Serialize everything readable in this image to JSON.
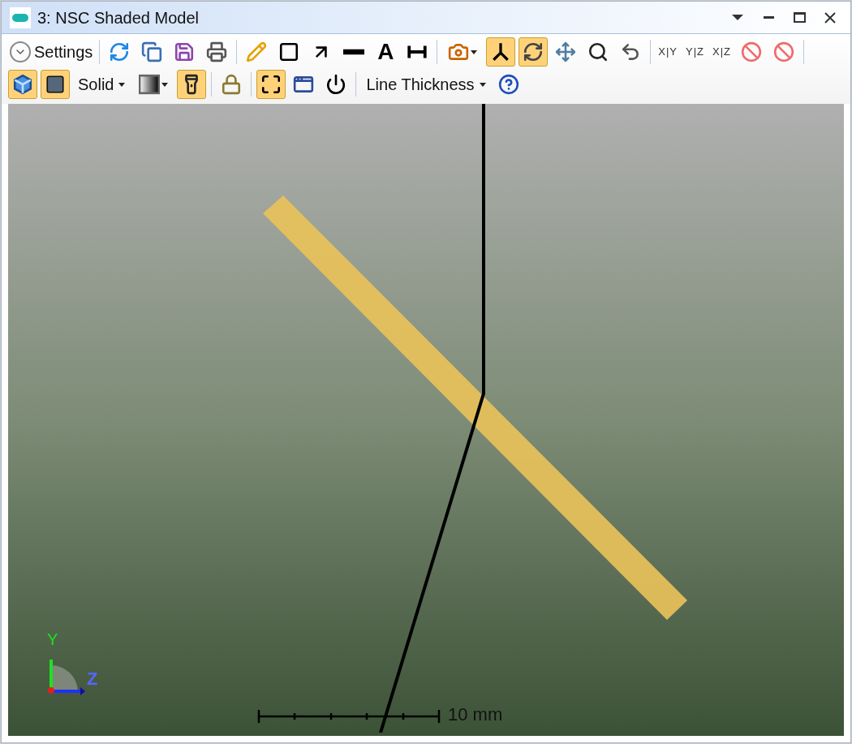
{
  "window": {
    "title": "3: NSC Shaded Model"
  },
  "toolbar_rows": [
    [
      {
        "kind": "settings",
        "label": "Settings"
      },
      {
        "kind": "separator"
      },
      {
        "kind": "icon",
        "selected": false
      },
      {
        "kind": "icon",
        "selected": false
      },
      {
        "kind": "icon",
        "selected": false
      },
      {
        "kind": "icon",
        "selected": false
      },
      {
        "kind": "separator"
      },
      {
        "kind": "icon",
        "selected": false
      },
      {
        "kind": "icon",
        "selected": false
      },
      {
        "kind": "icon",
        "selected": false
      },
      {
        "kind": "icon",
        "selected": false
      },
      {
        "kind": "glyph",
        "label": "A"
      },
      {
        "kind": "icon",
        "selected": false
      },
      {
        "kind": "separator"
      },
      {
        "kind": "icon-menu",
        "selected": false
      },
      {
        "kind": "icon",
        "selected": true
      },
      {
        "kind": "icon",
        "selected": true
      },
      {
        "kind": "icon",
        "selected": false
      },
      {
        "kind": "icon",
        "selected": false
      },
      {
        "kind": "icon",
        "selected": false
      },
      {
        "kind": "separator"
      },
      {
        "kind": "text",
        "label": "X|Y"
      },
      {
        "kind": "text",
        "label": "Y|Z"
      },
      {
        "kind": "text",
        "label": "X|Z"
      },
      {
        "kind": "icon",
        "selected": false
      },
      {
        "kind": "icon",
        "selected": false
      },
      {
        "kind": "separator"
      }
    ],
    [
      {
        "kind": "icon",
        "selected": true
      },
      {
        "kind": "icon",
        "selected": true
      },
      {
        "kind": "text-menu",
        "label": "Solid"
      },
      {
        "kind": "icon-menu",
        "selected": false
      },
      {
        "kind": "icon",
        "selected": true
      },
      {
        "kind": "separator"
      },
      {
        "kind": "icon",
        "selected": false
      },
      {
        "kind": "separator"
      },
      {
        "kind": "icon",
        "selected": true
      },
      {
        "kind": "icon",
        "selected": false
      },
      {
        "kind": "icon",
        "selected": false
      },
      {
        "kind": "separator"
      },
      {
        "kind": "text-menu",
        "label": "Line Thickness"
      },
      {
        "kind": "icon",
        "selected": false
      }
    ]
  ],
  "viewport": {
    "axis_labels": [
      "Y",
      "Z"
    ],
    "scale_label": "10 mm"
  }
}
